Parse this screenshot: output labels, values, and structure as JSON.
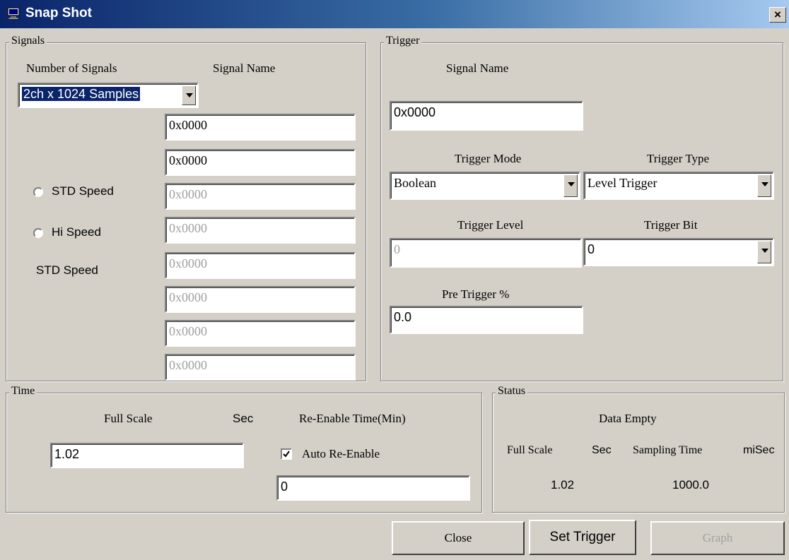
{
  "window": {
    "title": "Snap Shot",
    "close_glyph": "×"
  },
  "signals": {
    "legend": "Signals",
    "number_label": "Number of Signals",
    "name_label": "Signal Name",
    "number_value": "2ch x 1024 Samples",
    "fields": [
      "0x0000",
      "0x0000",
      "0x0000",
      "0x0000",
      "0x0000",
      "0x0000",
      "0x0000",
      "0x0000"
    ],
    "fields_enabled": [
      true,
      true,
      false,
      false,
      false,
      false,
      false,
      false
    ],
    "std_speed_label": "STD Speed",
    "hi_speed_label": "Hi Speed",
    "speed_status": "STD Speed"
  },
  "trigger": {
    "legend": "Trigger",
    "signal_name_label": "Signal Name",
    "signal_name_value": "0x0000",
    "mode_label": "Trigger Mode",
    "mode_value": "Boolean",
    "type_label": "Trigger Type",
    "type_value": "Level Trigger",
    "level_label": "Trigger Level",
    "level_value": "0",
    "bit_label": "Trigger Bit",
    "bit_value": "0",
    "pre_label": "Pre Trigger %",
    "pre_value": "0.0"
  },
  "time": {
    "legend": "Time",
    "full_scale_label": "Full Scale",
    "sec_label": "Sec",
    "reenable_label": "Re-Enable Time(Min)",
    "full_scale_value": "1.02",
    "auto_reenable_label": "Auto Re-Enable",
    "auto_reenable_checked": true,
    "reenable_value": "0"
  },
  "status": {
    "legend": "Status",
    "state": "Data Empty",
    "full_scale_label": "Full Scale",
    "sec_label": "Sec",
    "sampling_label": "Sampling Time",
    "misec_label": "miSec",
    "full_scale_value": "1.02",
    "sampling_value": "1000.0"
  },
  "buttons": {
    "close": "Close",
    "set_trigger": "Set Trigger",
    "graph": "Graph"
  },
  "icons": {
    "title_icon": "monitor-icon",
    "dropdown_icon": "chevron-down-icon",
    "check_icon": "checkmark-icon"
  },
  "colors": {
    "titlebar_start": "#0a246a",
    "titlebar_end": "#a6caf0",
    "face": "#d4d0c8",
    "selection": "#0a246a"
  }
}
